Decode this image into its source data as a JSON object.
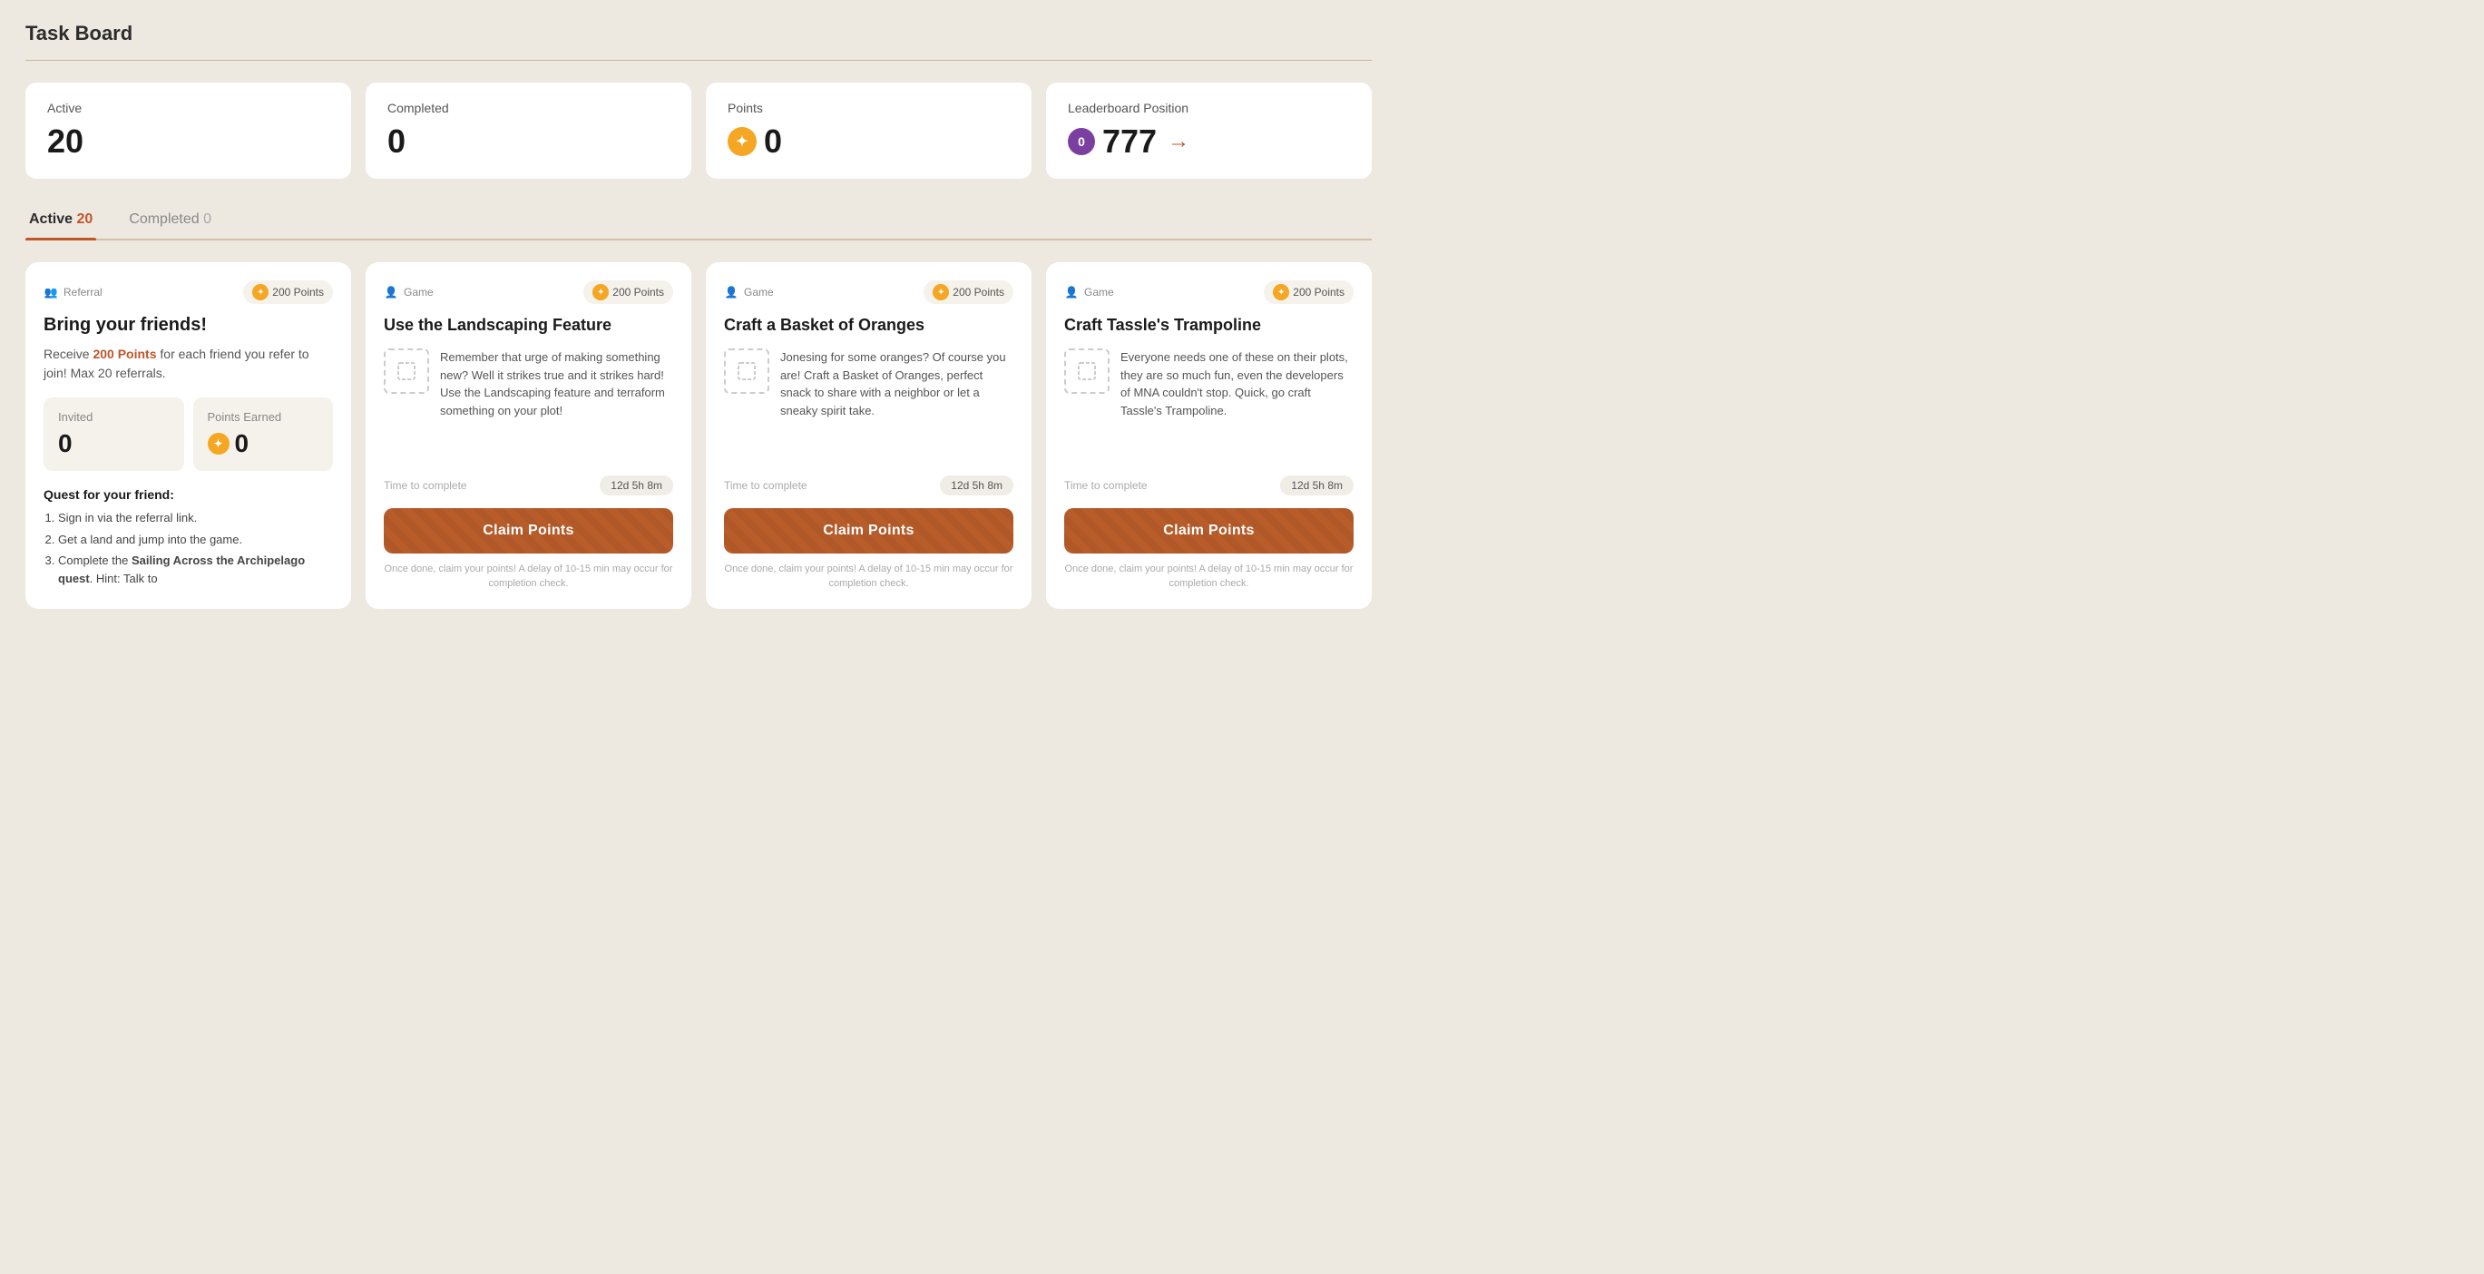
{
  "page": {
    "title": "Task Board"
  },
  "stats": [
    {
      "id": "active",
      "label": "Active",
      "value": "20",
      "icon": null
    },
    {
      "id": "completed",
      "label": "Completed",
      "value": "0",
      "icon": null
    },
    {
      "id": "points",
      "label": "Points",
      "value": "0",
      "icon": "star"
    },
    {
      "id": "leaderboard",
      "label": "Leaderboard Position",
      "value": "777",
      "icon": "rank"
    }
  ],
  "tabs": [
    {
      "id": "active",
      "label": "Active",
      "count": "20",
      "active": true
    },
    {
      "id": "completed",
      "label": "Completed",
      "count": "0",
      "active": false
    }
  ],
  "referral_card": {
    "type": "Referral",
    "points_label": "200 Points",
    "title": "Bring your friends!",
    "subtext_prefix": "Receive ",
    "subtext_highlight": "200 Points",
    "subtext_suffix": " for each friend you refer to join! Max 20 referrals.",
    "invited_label": "Invited",
    "invited_value": "0",
    "points_earned_label": "Points Earned",
    "points_earned_value": "0",
    "quest_title": "Quest for your friend:",
    "quest_items": [
      "Sign in via the referral link.",
      "Get a land and jump into the game.",
      "Complete the Sailing Across the Archipelago quest. Hint: Talk to"
    ],
    "quest_bold_items": [
      false,
      false,
      "Sailing Across the Archipelago quest"
    ]
  },
  "task_cards": [
    {
      "id": "landscaping",
      "type": "Game",
      "points_label": "200 Points",
      "title": "Use the Landscaping Feature",
      "description": "Remember that urge of making something new? Well it strikes true and it strikes hard! Use the Landscaping feature and terraform something on your plot!",
      "time_label": "Time to complete",
      "time_value": "12d 5h 8m",
      "claim_label": "Claim Points",
      "claim_note": "Once done, claim your points! A delay of 10-15 min may occur for completion check."
    },
    {
      "id": "basket-oranges",
      "type": "Game",
      "points_label": "200 Points",
      "title": "Craft a Basket of Oranges",
      "description": "Jonesing for some oranges? Of course you are! Craft a Basket of Oranges, perfect snack to share with a neighbor or let a sneaky spirit take.",
      "time_label": "Time to complete",
      "time_value": "12d 5h 8m",
      "claim_label": "Claim Points",
      "claim_note": "Once done, claim your points! A delay of 10-15 min may occur for completion check."
    },
    {
      "id": "tassle-trampoline",
      "type": "Game",
      "points_label": "200 Points",
      "title": "Craft Tassle's Trampoline",
      "description": "Everyone needs one of these on their plots, they are so much fun, even the developers of MNA couldn't stop. Quick, go craft Tassle's Trampoline.",
      "time_label": "Time to complete",
      "time_value": "12d 5h 8m",
      "claim_label": "Claim Points",
      "claim_note": "Once done, claim your points! A delay of 10-15 min may occur for completion check."
    }
  ],
  "icons": {
    "star": "✦",
    "person": "👤",
    "people": "👥",
    "arrow_right": "→",
    "rank_zero": "0"
  }
}
